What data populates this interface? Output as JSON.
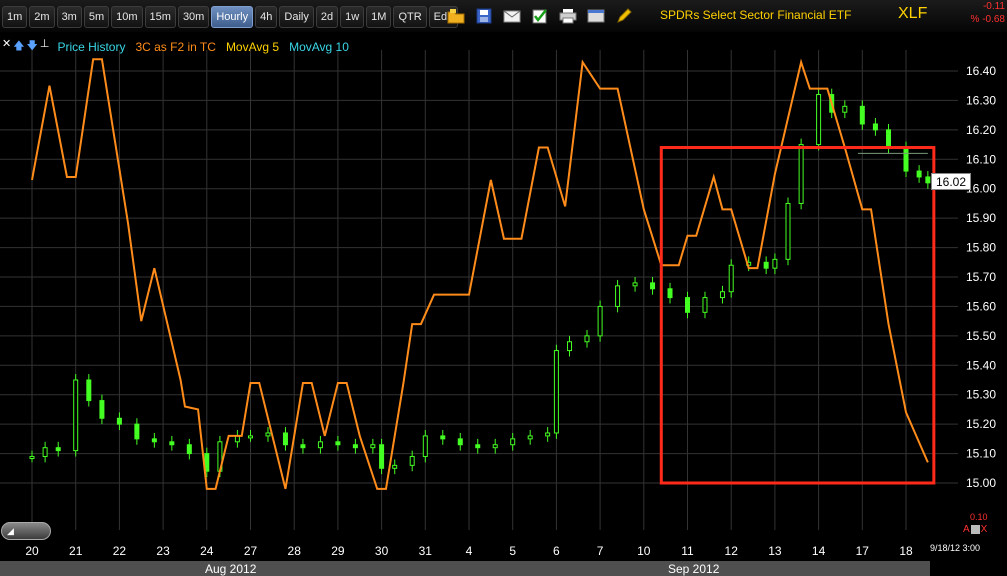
{
  "toolbar": {
    "timeframes": [
      "1m",
      "2m",
      "3m",
      "5m",
      "10m",
      "15m",
      "30m",
      "Hourly",
      "4h",
      "Daily",
      "2d",
      "1w",
      "1M",
      "QTR",
      "Edit"
    ],
    "active_timeframe": "Hourly",
    "icons": [
      "folder-icon",
      "save-icon",
      "email-icon",
      "checkbox-icon",
      "print-icon",
      "window-icon",
      "pencil-icon"
    ]
  },
  "header": {
    "title": "SPDRs Select Sector Financial ETF",
    "symbol": "XLF",
    "change": "-0.11",
    "change_pct": "% -0.68"
  },
  "legend": {
    "items": [
      {
        "label": "Price History",
        "color": "#39d6e6"
      },
      {
        "label": "3C as F2 in TC",
        "color": "#ff8c1a"
      },
      {
        "label": "MovAvg 5",
        "color": "#ffd200"
      },
      {
        "label": "MovAvg 10",
        "color": "#39d6e6"
      }
    ]
  },
  "price_tag": "16.02",
  "volume_axis": {
    "max": "0.10"
  },
  "timestamp": "9/18/12 3:00",
  "months": [
    {
      "label": "Aug 2012"
    },
    {
      "label": "Sep 2012"
    }
  ],
  "colors": {
    "price": "#44ff22",
    "indicator": "#ff8c1a",
    "highlight_box": "#ff2a1a",
    "grid": "#333333"
  },
  "chart_data": {
    "type": "line",
    "title": "SPDRs Select Sector Financial ETF",
    "xlabel": "",
    "ylabel": "",
    "x_categories": [
      "20",
      "21",
      "22",
      "23",
      "24",
      "27",
      "28",
      "29",
      "30",
      "31",
      "4",
      "5",
      "6",
      "7",
      "10",
      "11",
      "12",
      "13",
      "14",
      "17",
      "18"
    ],
    "yticks": [
      "16.40",
      "16.30",
      "16.20",
      "16.10",
      "16.00",
      "15.90",
      "15.80",
      "15.70",
      "15.60",
      "15.50",
      "15.40",
      "15.30",
      "15.20",
      "15.10",
      "15.00"
    ],
    "ylim": [
      14.95,
      16.47
    ],
    "grid": true,
    "highlight_box": {
      "x_start": 14.4,
      "x_end": 20.5,
      "y_low": 15.0,
      "y_high": 16.14
    },
    "resistance_line": {
      "x_start": 18.9,
      "x_end": 20.5,
      "y": 16.12
    },
    "series": [
      {
        "name": "Price History",
        "style": "candlestick",
        "values": [
          [
            0.0,
            15.09
          ],
          [
            0.3,
            15.12
          ],
          [
            0.6,
            15.11
          ],
          [
            1.0,
            15.35
          ],
          [
            1.3,
            15.28
          ],
          [
            1.6,
            15.22
          ],
          [
            2.0,
            15.2
          ],
          [
            2.4,
            15.15
          ],
          [
            2.8,
            15.14
          ],
          [
            3.2,
            15.13
          ],
          [
            3.6,
            15.1
          ],
          [
            4.0,
            15.04
          ],
          [
            4.3,
            15.14
          ],
          [
            4.7,
            15.16
          ],
          [
            5.0,
            15.16
          ],
          [
            5.4,
            15.17
          ],
          [
            5.8,
            15.13
          ],
          [
            6.2,
            15.12
          ],
          [
            6.6,
            15.14
          ],
          [
            7.0,
            15.13
          ],
          [
            7.4,
            15.12
          ],
          [
            7.8,
            15.13
          ],
          [
            8.0,
            15.05
          ],
          [
            8.3,
            15.06
          ],
          [
            8.7,
            15.09
          ],
          [
            9.0,
            15.16
          ],
          [
            9.4,
            15.15
          ],
          [
            9.8,
            15.13
          ],
          [
            10.2,
            15.12
          ],
          [
            10.6,
            15.13
          ],
          [
            11.0,
            15.15
          ],
          [
            11.4,
            15.16
          ],
          [
            11.8,
            15.17
          ],
          [
            12.0,
            15.45
          ],
          [
            12.3,
            15.48
          ],
          [
            12.7,
            15.5
          ],
          [
            13.0,
            15.6
          ],
          [
            13.4,
            15.67
          ],
          [
            13.8,
            15.68
          ],
          [
            14.2,
            15.66
          ],
          [
            14.6,
            15.63
          ],
          [
            15.0,
            15.58
          ],
          [
            15.4,
            15.63
          ],
          [
            15.8,
            15.65
          ],
          [
            16.0,
            15.74
          ],
          [
            16.4,
            15.75
          ],
          [
            16.8,
            15.73
          ],
          [
            17.0,
            15.76
          ],
          [
            17.3,
            15.95
          ],
          [
            17.6,
            16.15
          ],
          [
            18.0,
            16.32
          ],
          [
            18.3,
            16.26
          ],
          [
            18.6,
            16.28
          ],
          [
            19.0,
            16.22
          ],
          [
            19.3,
            16.2
          ],
          [
            19.6,
            16.14
          ],
          [
            20.0,
            16.06
          ],
          [
            20.3,
            16.04
          ],
          [
            20.5,
            16.02
          ]
        ]
      },
      {
        "name": "3C as F2 in TC",
        "style": "line",
        "values": [
          [
            0.0,
            16.03
          ],
          [
            0.4,
            16.35
          ],
          [
            0.8,
            16.04
          ],
          [
            1.0,
            16.04
          ],
          [
            1.4,
            16.44
          ],
          [
            1.6,
            16.44
          ],
          [
            2.2,
            15.88
          ],
          [
            2.5,
            15.55
          ],
          [
            2.8,
            15.73
          ],
          [
            3.4,
            15.35
          ],
          [
            3.5,
            15.26
          ],
          [
            3.8,
            15.25
          ],
          [
            4.0,
            14.98
          ],
          [
            4.2,
            14.98
          ],
          [
            4.5,
            15.16
          ],
          [
            4.8,
            15.16
          ],
          [
            5.0,
            15.34
          ],
          [
            5.2,
            15.34
          ],
          [
            5.5,
            15.16
          ],
          [
            5.8,
            14.98
          ],
          [
            6.0,
            15.16
          ],
          [
            6.2,
            15.34
          ],
          [
            6.4,
            15.34
          ],
          [
            6.7,
            15.16
          ],
          [
            7.0,
            15.34
          ],
          [
            7.2,
            15.34
          ],
          [
            7.5,
            15.16
          ],
          [
            7.9,
            14.98
          ],
          [
            8.1,
            14.98
          ],
          [
            8.5,
            15.34
          ],
          [
            8.7,
            15.54
          ],
          [
            8.9,
            15.54
          ],
          [
            9.2,
            15.64
          ],
          [
            9.6,
            15.64
          ],
          [
            10.0,
            15.64
          ],
          [
            10.5,
            16.03
          ],
          [
            10.8,
            15.83
          ],
          [
            11.2,
            15.83
          ],
          [
            11.6,
            16.14
          ],
          [
            11.8,
            16.14
          ],
          [
            12.2,
            15.94
          ],
          [
            12.6,
            16.43
          ],
          [
            13.0,
            16.34
          ],
          [
            13.4,
            16.34
          ],
          [
            14.0,
            15.93
          ],
          [
            14.4,
            15.74
          ],
          [
            14.8,
            15.74
          ],
          [
            15.0,
            15.84
          ],
          [
            15.2,
            15.84
          ],
          [
            15.6,
            16.04
          ],
          [
            15.8,
            15.93
          ],
          [
            16.0,
            15.93
          ],
          [
            16.4,
            15.73
          ],
          [
            16.6,
            15.73
          ],
          [
            17.0,
            16.05
          ],
          [
            17.6,
            16.43
          ],
          [
            17.8,
            16.34
          ],
          [
            18.2,
            16.34
          ],
          [
            18.6,
            16.14
          ],
          [
            19.0,
            15.93
          ],
          [
            19.2,
            15.93
          ],
          [
            19.6,
            15.54
          ],
          [
            20.0,
            15.24
          ],
          [
            20.5,
            15.07
          ]
        ]
      }
    ]
  }
}
